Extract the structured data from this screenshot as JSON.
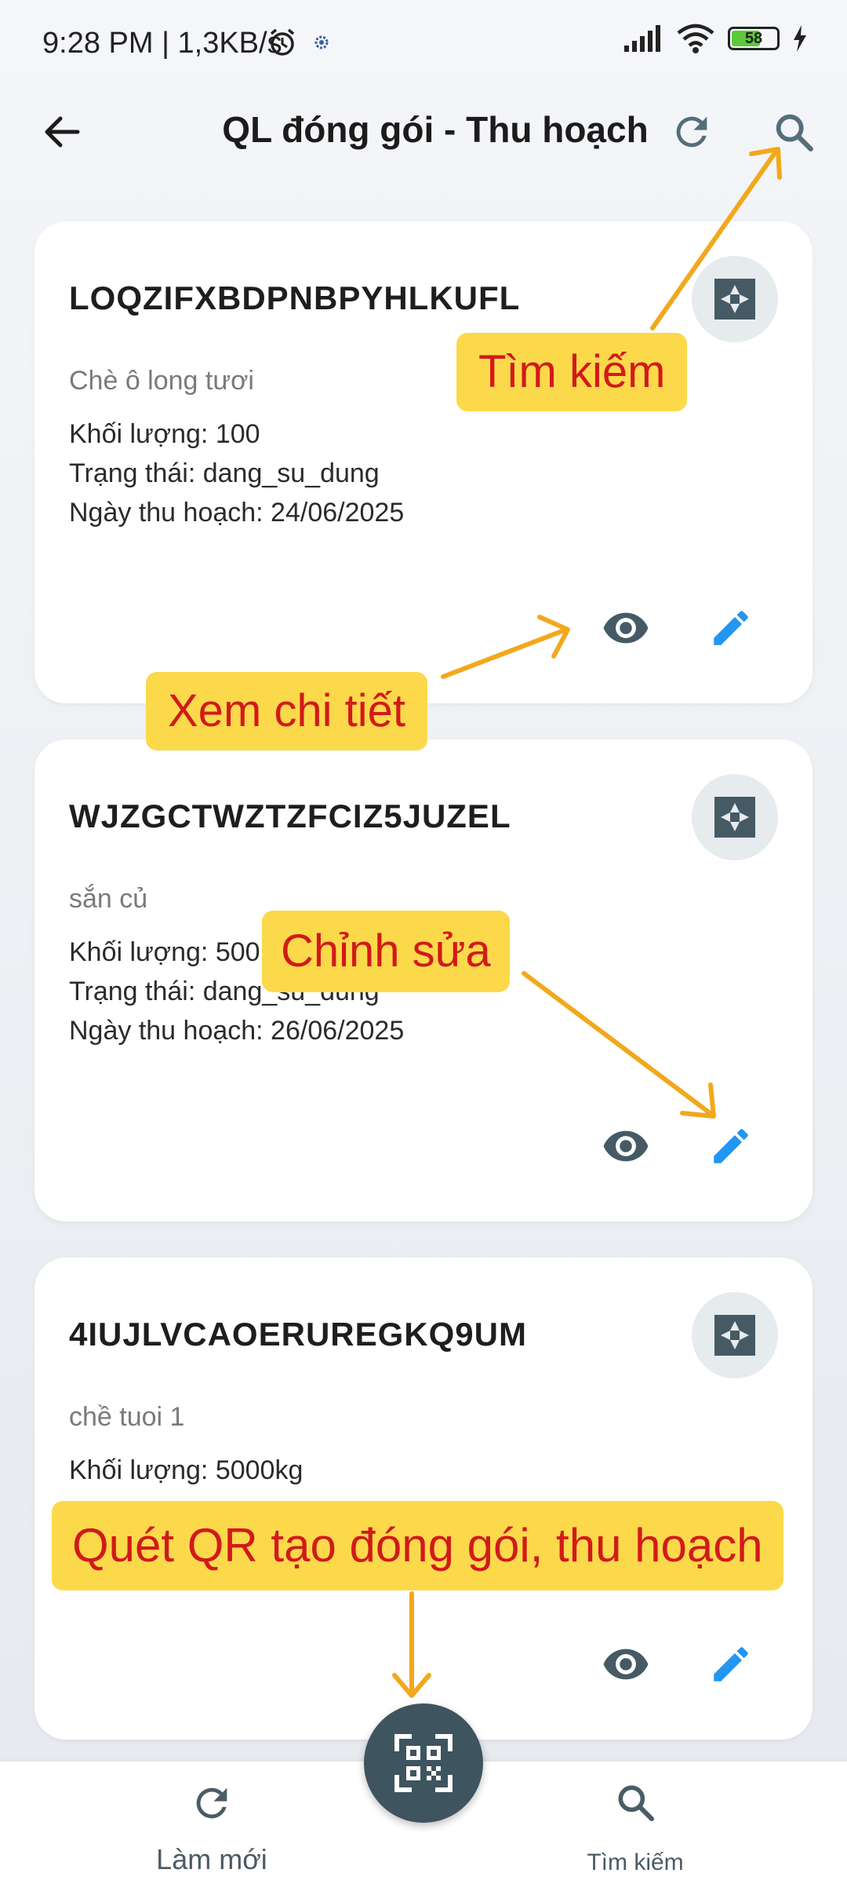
{
  "status_bar": {
    "time_speed": "9:28 PM | 1,3KB/s",
    "battery": "58"
  },
  "app_bar": {
    "title": "QL đóng gói - Thu hoạch"
  },
  "cards": [
    {
      "code": "LOQZIFXBDPNBPYHLKUFL",
      "product": "Chè ô long tươi",
      "weight": "Khối lượng: 100",
      "status": "Trạng thái: dang_su_dung",
      "harvest_date": "Ngày thu hoạch: 24/06/2025"
    },
    {
      "code": "WJZGCTWZTZFCIZ5JUZEL",
      "product": "sắn củ",
      "weight": "Khối lượng: 500",
      "status": "Trạng thái: dang_su_dung",
      "harvest_date": "Ngày thu hoạch: 26/06/2025"
    },
    {
      "code": "4IUJLVCAOERUREGKQ9UM",
      "product": "chề tuoi 1",
      "weight": "Khối lượng: 5000kg",
      "status": "",
      "harvest_date": ""
    }
  ],
  "callouts": {
    "search": "Tìm kiếm",
    "view": "Xem chi tiết",
    "edit": "Chỉnh sửa",
    "scan": "Quét QR tạo đóng gói, thu hoạch"
  },
  "bottom_nav": {
    "refresh_label": "Làm mới",
    "search_label": "Tìm kiếm"
  },
  "colors": {
    "accent_blue": "#2196f3",
    "icon_slate": "#455a64",
    "callout_bg": "#fcd94b",
    "callout_text": "#d11a1a",
    "arrow": "#f2a81d"
  }
}
